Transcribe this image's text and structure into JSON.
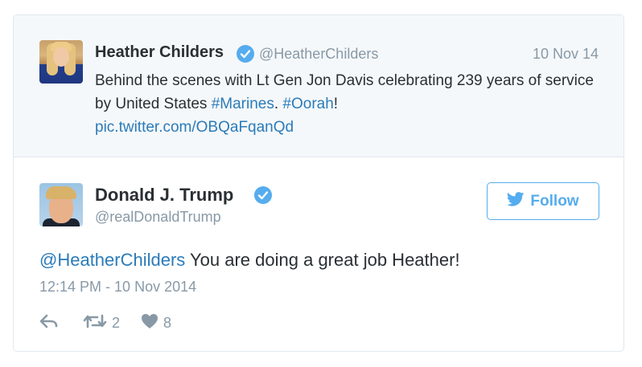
{
  "quoted_tweet": {
    "author_name": "Heather Childers",
    "handle": "@HeatherChilders",
    "date": "10 Nov 14",
    "text_plain_1": "Behind the scenes with Lt Gen Jon Davis celebrating 239 years of service by United States ",
    "hashtag_1": "#Marines",
    "text_plain_2": ". ",
    "hashtag_2": "#Oorah",
    "text_plain_3": "!",
    "media_link": "pic.twitter.com/OBQaFqanQd",
    "verified_icon": "verified-badge-icon"
  },
  "tweet": {
    "author_name": "Donald J. Trump",
    "handle": "@realDonaldTrump",
    "mention": "@HeatherChilders",
    "text": " You are doing a great job Heather!",
    "timestamp": "12:14 PM - 10 Nov 2014",
    "verified_icon": "verified-badge-icon"
  },
  "follow_button": {
    "label": "Follow",
    "icon": "twitter-bird-icon"
  },
  "actions": {
    "reply_icon": "reply-icon",
    "retweet_icon": "retweet-icon",
    "retweet_count": "2",
    "like_icon": "heart-icon",
    "like_count": "8"
  },
  "colors": {
    "accent": "#55acee",
    "link": "#2b7bb9",
    "muted": "#8899a6",
    "text": "#292f33",
    "quoted_bg": "#f5f8fa",
    "border": "#e1e8ed"
  }
}
